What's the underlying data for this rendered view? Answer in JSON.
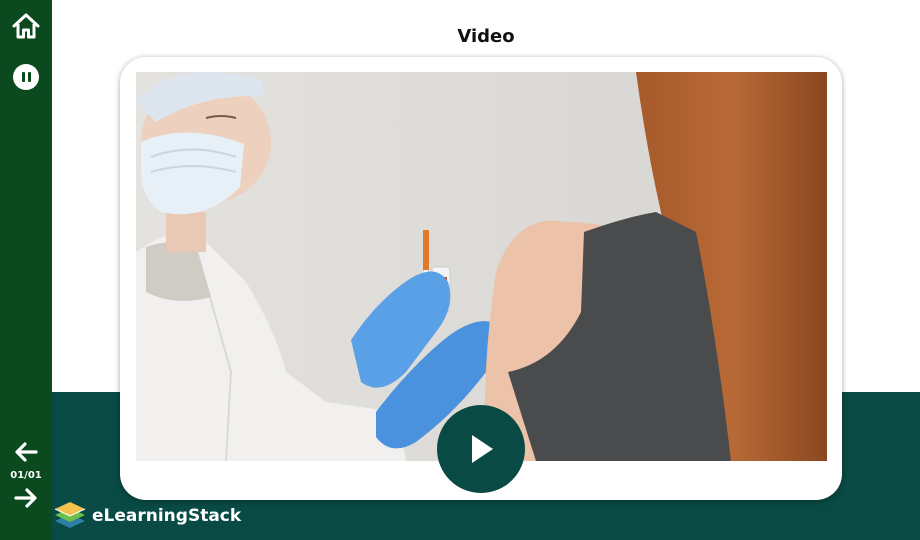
{
  "slide": {
    "title": "Video",
    "page_counter": "01/01"
  },
  "sidebar": {
    "home_icon": "home-icon",
    "pause_icon": "pause-icon",
    "prev_icon": "arrow-left-icon",
    "next_icon": "arrow-right-icon"
  },
  "player": {
    "play_icon": "play-icon"
  },
  "brand": {
    "name": "eLearningStack"
  },
  "colors": {
    "sidebar": "#0b4a1e",
    "band": "#0a4a44",
    "accent_play": "#0a4a44",
    "background": "#ffffff"
  }
}
